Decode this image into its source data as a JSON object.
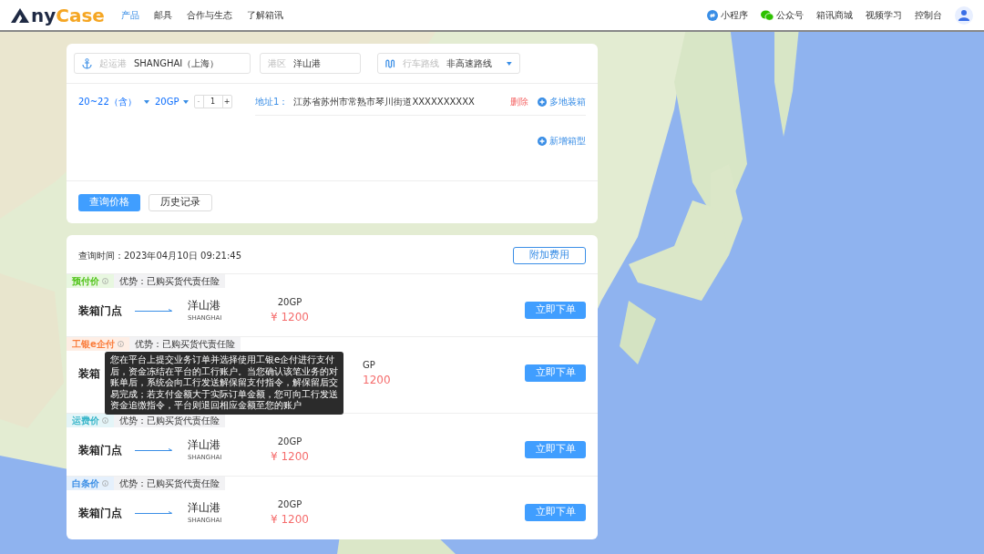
{
  "navbar": {
    "logo": {
      "dark_text": "ny",
      "accent_text": "Case"
    },
    "menu": [
      {
        "label": "产品",
        "selected": true
      },
      {
        "label": "邮具",
        "selected": false
      },
      {
        "label": "合作与生态",
        "selected": false
      },
      {
        "label": "了解箱讯",
        "selected": false
      }
    ],
    "links": [
      {
        "label": "小程序",
        "kind": "miniapp"
      },
      {
        "label": "公众号",
        "kind": "wechat"
      },
      {
        "label": "箱讯商城",
        "kind": "plain"
      },
      {
        "label": "视频学习",
        "kind": "plain"
      },
      {
        "label": "控制台",
        "kind": "plain"
      }
    ]
  },
  "query": {
    "fields": [
      {
        "kind": "anchor",
        "label": "起运港",
        "value": "SHANGHAI（上海）"
      },
      {
        "kind": "plain",
        "label": "港区",
        "value": "洋山港"
      },
      {
        "kind": "route",
        "label": "行车路线",
        "value": "非高速路线"
      }
    ],
    "weight": "20~22（含）",
    "container": "20GP",
    "quantity": "1",
    "minus": "-",
    "plus": "+",
    "address_label": "地址1：",
    "address": "江苏省苏州市常熟市琴川街道XXXXXXXXXX",
    "delete": "删除",
    "multi_pickup": "多地装箱",
    "add_container": "新增箱型",
    "buttons": [
      {
        "label": "查询价格",
        "kind": "primary"
      },
      {
        "label": "历史记录",
        "kind": "outline"
      }
    ]
  },
  "results": {
    "time": "查询时间：2023年04月10日 09:21:45",
    "extra_button": "附加费用",
    "rows": [
      {
        "tag": "预付价",
        "color": "#52c41a",
        "advantage": "优势：已购买货代责任险",
        "origin": "装箱门点",
        "destination": "洋山港",
        "destination_en": "SHANGHAI",
        "container": "20GP",
        "price": "¥ 1200",
        "button": "立即下单"
      },
      {
        "tag": "工银e企付",
        "color": "#fa7d3c",
        "advantage": "优势：已购买货代责任险",
        "origin": "装箱",
        "container": "GP",
        "price": "1200",
        "button": "立即下单",
        "tooltip": "您在平台上提交业务订单并选择使用工银e企付进行支付后，资金冻结在平台的工行账户。当您确认该笔业务的对账单后，系统会向工行发送解保留支付指令，解保留后交易完成；若支付金额大于实际订单金额，您可向工行发送资金追缴指令，平台则退回相应金额至您的账户"
      },
      {
        "tag": "运费价",
        "color": "#36b5c9",
        "advantage": "优势：已购买货代责任险",
        "origin": "装箱门点",
        "destination": "洋山港",
        "destination_en": "SHANGHAI",
        "container": "20GP",
        "price": "¥ 1200",
        "button": "立即下单"
      },
      {
        "tag": "白条价",
        "color": "#3a8ee6",
        "advantage": "优势：已购买货代责任险",
        "origin": "装箱门点",
        "destination": "洋山港",
        "destination_en": "SHANGHAI",
        "container": "20GP",
        "price": "¥ 1200",
        "button": "立即下单"
      }
    ]
  }
}
